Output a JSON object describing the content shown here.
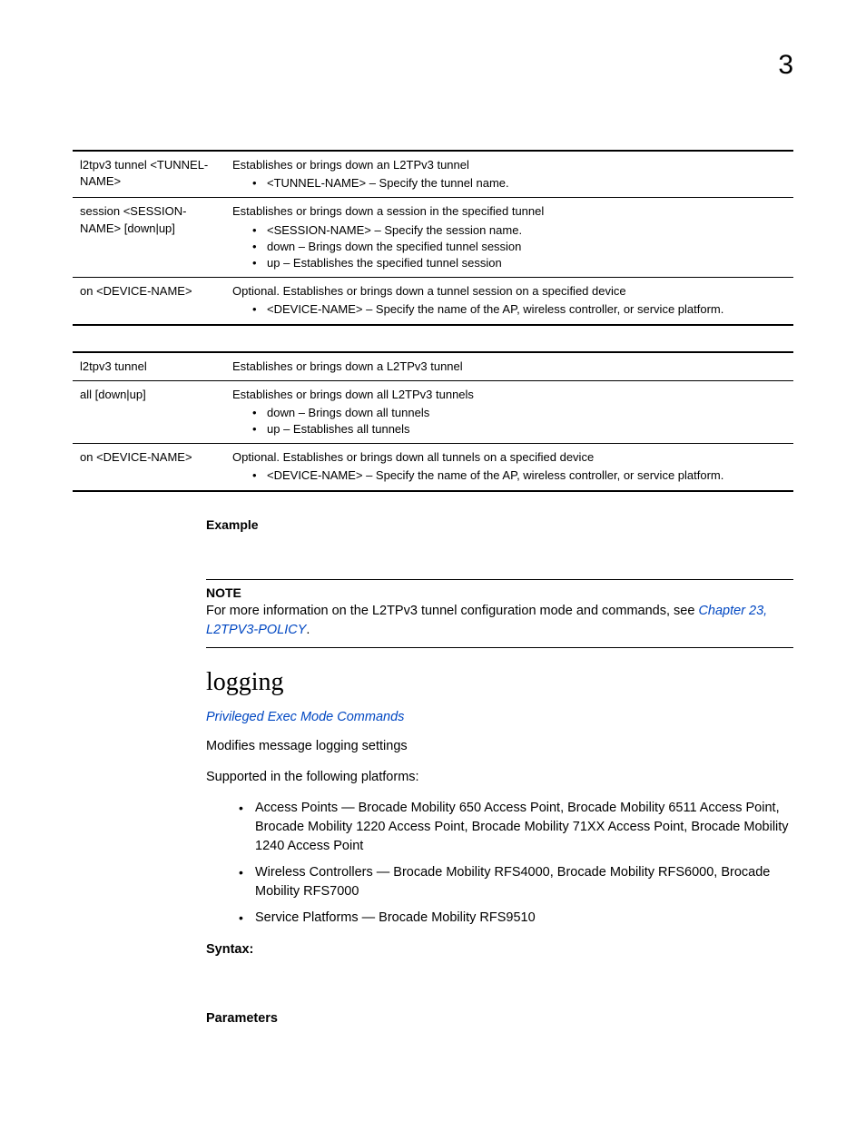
{
  "page_number": "3",
  "table1": {
    "rows": [
      {
        "param": "l2tpv3 tunnel <TUNNEL-NAME>",
        "intro": "Establishes or brings down an L2TPv3 tunnel",
        "items": [
          "<TUNNEL-NAME> – Specify the tunnel name."
        ]
      },
      {
        "param": "session <SESSION-NAME> [down|up]",
        "intro": "Establishes or brings down a session in the specified tunnel",
        "items": [
          "<SESSION-NAME> – Specify the session name.",
          "down – Brings down the specified tunnel session",
          "up – Establishes the specified tunnel session"
        ]
      },
      {
        "param": "on <DEVICE-NAME>",
        "intro": "Optional. Establishes or brings down a tunnel session on a specified device",
        "items": [
          "<DEVICE-NAME> – Specify the name of the AP, wireless controller, or service platform."
        ]
      }
    ]
  },
  "table2": {
    "rows": [
      {
        "param": "l2tpv3 tunnel",
        "intro": "Establishes or brings down a L2TPv3 tunnel",
        "items": []
      },
      {
        "param": "all [down|up]",
        "intro": "Establishes or brings down all L2TPv3 tunnels",
        "items": [
          "down – Brings down all tunnels",
          "up – Establishes all tunnels"
        ]
      },
      {
        "param": "on <DEVICE-NAME>",
        "intro": "Optional. Establishes or brings down all tunnels on a specified device",
        "items": [
          "<DEVICE-NAME> – Specify the name of the AP, wireless controller, or service platform."
        ]
      }
    ]
  },
  "example_label": "Example",
  "note": {
    "label": "NOTE",
    "text_before": "For more information on the L2TPv3 tunnel configuration mode and commands, see ",
    "link": "Chapter 23, L2TPV3-POLICY",
    "text_after": "."
  },
  "heading": "logging",
  "sub_link": "Privileged Exec Mode Commands",
  "p1": "Modifies message logging settings",
  "p2": "Supported in the following platforms:",
  "platforms": [
    "Access Points — Brocade Mobility 650 Access Point, Brocade Mobility 6511 Access Point, Brocade Mobility 1220 Access Point, Brocade Mobility 71XX Access Point, Brocade Mobility 1240 Access Point",
    "Wireless Controllers — Brocade Mobility RFS4000, Brocade Mobility RFS6000, Brocade Mobility RFS7000",
    "Service Platforms — Brocade Mobility RFS9510"
  ],
  "syntax_label": "Syntax:",
  "parameters_label": "Parameters"
}
